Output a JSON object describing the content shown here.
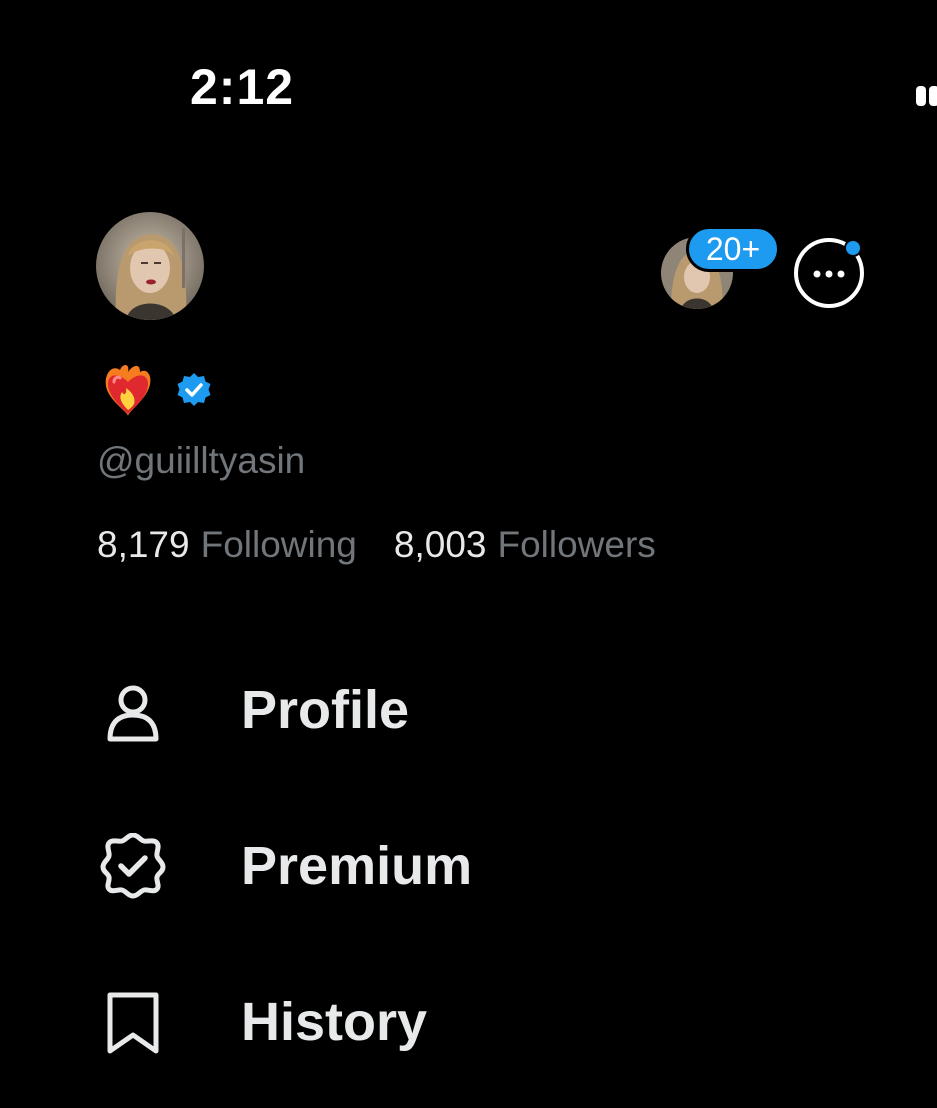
{
  "status_bar": {
    "time": "2:12"
  },
  "header": {
    "avatar_icon": "profile-avatar",
    "account_switcher": {
      "avatar_icon": "secondary-account-avatar",
      "badge_count": "20+"
    },
    "more_icon": "more-options-icon"
  },
  "profile": {
    "display_name_emoji": "❤️‍🔥",
    "verified_icon": "verified-badge-icon",
    "handle": "@guiilltyasin",
    "following_count": "8,179",
    "following_label": "Following",
    "followers_count": "8,003",
    "followers_label": "Followers"
  },
  "menu": {
    "items": [
      {
        "label": "Profile",
        "icon": "person-icon"
      },
      {
        "label": "Premium",
        "icon": "verified-outline-icon"
      },
      {
        "label": "History",
        "icon": "bookmark-icon"
      }
    ]
  },
  "colors": {
    "background": "#000000",
    "primary_text": "#e7e9ea",
    "secondary_text": "#71767b",
    "accent": "#1d9bf0"
  }
}
